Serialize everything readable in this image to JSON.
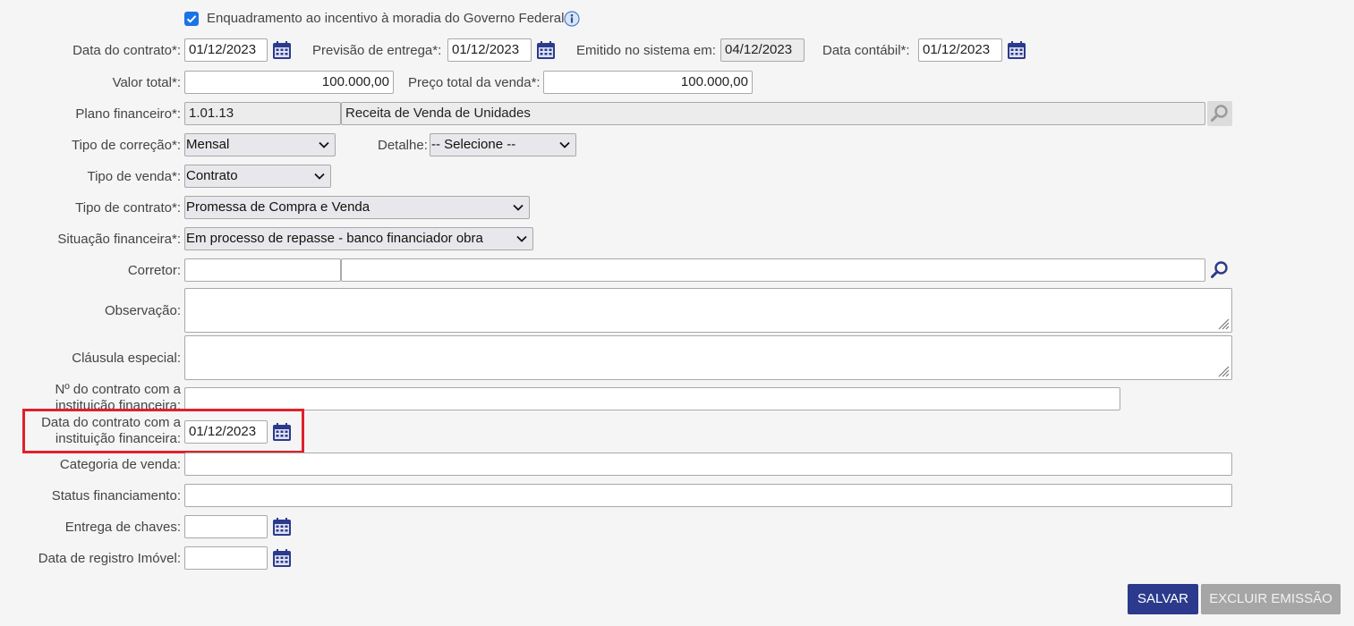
{
  "incentive": {
    "checked": true,
    "label": "Enquadramento ao incentivo à moradia do Governo Federal"
  },
  "data_contrato": {
    "label": "Data do contrato*:",
    "value": "01/12/2023"
  },
  "previsao_entrega": {
    "label": "Previsão de entrega*:",
    "value": "01/12/2023"
  },
  "emitido_sistema": {
    "label": "Emitido no sistema em:",
    "value": "04/12/2023"
  },
  "data_contabil": {
    "label": "Data contábil*:",
    "value": "01/12/2023"
  },
  "valor_total": {
    "label": "Valor total*:",
    "value": "100.000,00"
  },
  "preco_total_venda": {
    "label": "Preço total da venda*:",
    "value": "100.000,00"
  },
  "plano_financeiro": {
    "label": "Plano financeiro*:",
    "code": "1.01.13",
    "description": "Receita de Venda de Unidades"
  },
  "tipo_correcao": {
    "label": "Tipo de correção*:",
    "value": "Mensal"
  },
  "detalhe": {
    "label": "Detalhe:",
    "value": "-- Selecione --"
  },
  "tipo_venda": {
    "label": "Tipo de venda*:",
    "value": "Contrato"
  },
  "tipo_contrato": {
    "label": "Tipo de contrato*:",
    "value": "Promessa de Compra e Venda"
  },
  "situacao_financeira": {
    "label": "Situação financeira*:",
    "value": "Em processo de repasse - banco financiador obra"
  },
  "corretor": {
    "label": "Corretor:",
    "code": "",
    "name": ""
  },
  "observacao": {
    "label": "Observação:"
  },
  "clausula_especial": {
    "label": "Cláusula especial:"
  },
  "num_contrato_if": {
    "label_line1": "Nº do contrato com a",
    "label_line2": "instituição financeira:",
    "value": ""
  },
  "data_contrato_if": {
    "label_line1": "Data do contrato com a",
    "label_line2": "instituição financeira:",
    "value": "01/12/2023"
  },
  "categoria_venda": {
    "label": "Categoria de venda:",
    "value": ""
  },
  "status_financiamento": {
    "label": "Status financiamento:",
    "value": ""
  },
  "entrega_chaves": {
    "label": "Entrega de chaves:",
    "value": ""
  },
  "data_registro_imovel": {
    "label": "Data de registro Imóvel:",
    "value": ""
  },
  "buttons": {
    "save": "SALVAR",
    "delete": "EXCLUIR EMISSÃO"
  },
  "colors": {
    "accent": "#2b3a8c",
    "highlight": "#e0202a",
    "disabled_button": "#a6a6a6"
  }
}
